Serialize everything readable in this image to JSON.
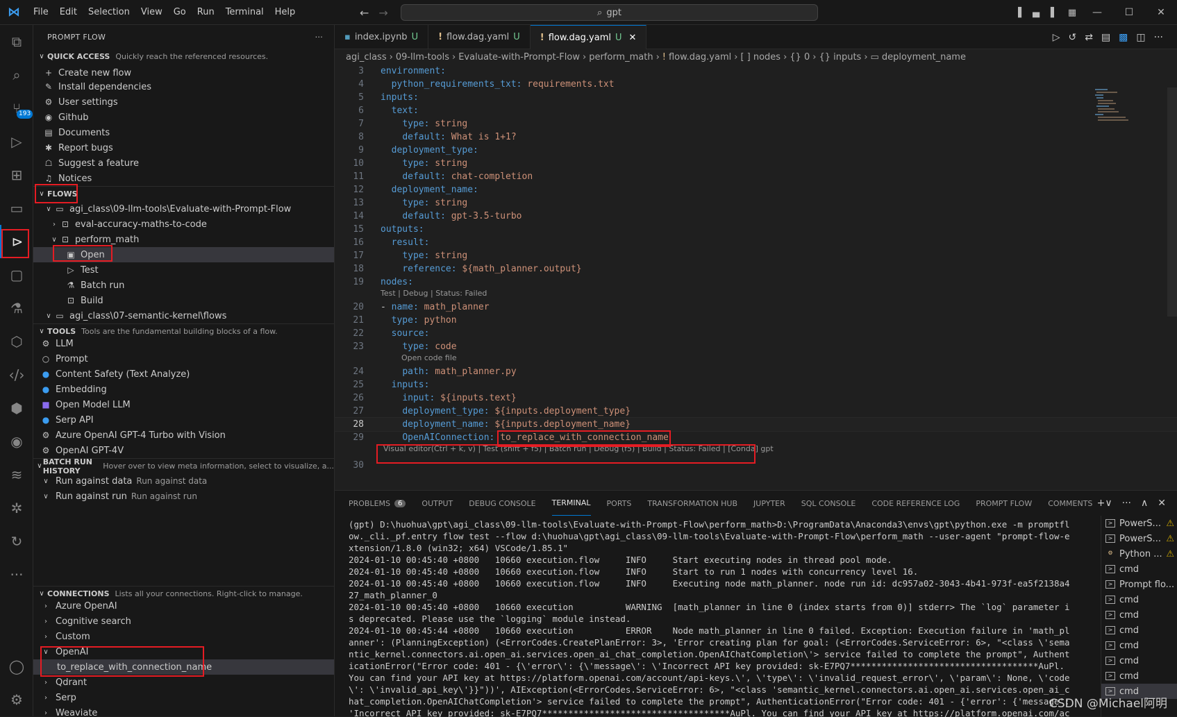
{
  "menu": [
    "File",
    "Edit",
    "Selection",
    "View",
    "Go",
    "Run",
    "Terminal",
    "Help"
  ],
  "search": {
    "text": "gpt"
  },
  "activity": {
    "scm_badge": "193"
  },
  "sidebar": {
    "title": "PROMPT FLOW",
    "quick_access": {
      "title": "QUICK ACCESS",
      "desc": "Quickly reach the referenced resources.",
      "items": [
        "Create new flow",
        "Install dependencies",
        "User settings",
        "Github",
        "Documents",
        "Report bugs",
        "Suggest a feature",
        "Notices"
      ]
    },
    "flows": {
      "title": "FLOWS",
      "root1": "agi_class\\09-llm-tools\\Evaluate-with-Prompt-Flow",
      "child1": "eval-accuracy-maths-to-code",
      "child2": "perform_math",
      "actions": [
        "Open",
        "Test",
        "Batch run",
        "Build"
      ],
      "root2": "agi_class\\07-semantic-kernel\\flows"
    },
    "tools": {
      "title": "TOOLS",
      "desc": "Tools are the fundamental building blocks of a flow.",
      "items": [
        "LLM",
        "Prompt",
        "Content Safety (Text Analyze)",
        "Embedding",
        "Open Model LLM",
        "Serp API",
        "Azure OpenAI GPT-4 Turbo with Vision",
        "OpenAI GPT-4V"
      ]
    },
    "batch": {
      "title": "BATCH RUN HISTORY",
      "desc": "Hover over to view meta information, select to visualize, a...",
      "items": [
        {
          "label": "Run against data",
          "sub": "Run against data"
        },
        {
          "label": "Run against run",
          "sub": "Run against run"
        }
      ]
    },
    "connections": {
      "title": "CONNECTIONS",
      "desc": "Lists all your connections. Right-click to manage.",
      "items": [
        "Azure OpenAI",
        "Cognitive search",
        "Custom",
        "OpenAI"
      ],
      "child": "to_replace_with_connection_name",
      "items2": [
        "Qdrant",
        "Serp",
        "Weaviate"
      ]
    }
  },
  "tabs": [
    {
      "label": "index.ipynb",
      "mark": "U"
    },
    {
      "label": "flow.dag.yaml",
      "mark": "U"
    },
    {
      "label": "flow.dag.yaml",
      "mark": "U"
    }
  ],
  "breadcrumb": [
    "agi_class",
    "09-llm-tools",
    "Evaluate-with-Prompt-Flow",
    "perform_math",
    "flow.dag.yaml",
    "[ ] nodes",
    "{} 0",
    "{} inputs",
    "deployment_name"
  ],
  "code": {
    "l3": "environment:",
    "l4k": "python_requirements_txt:",
    "l4v": "requirements.txt",
    "l5": "inputs:",
    "l6": "text:",
    "l7k": "type:",
    "l7v": "string",
    "l8k": "default:",
    "l8v": "What is 1+1?",
    "l9": "deployment_type:",
    "l10k": "type:",
    "l10v": "string",
    "l11k": "default:",
    "l11v": "chat-completion",
    "l12": "deployment_name:",
    "l13k": "type:",
    "l13v": "string",
    "l14k": "default:",
    "l14v": "gpt-3.5-turbo",
    "l15": "outputs:",
    "l16": "result:",
    "l17k": "type:",
    "l17v": "string",
    "l18k": "reference:",
    "l18v": "${math_planner.output}",
    "l19": "nodes:",
    "lens1": "Test | Debug | Status: Failed",
    "l20k": "name:",
    "l20v": "math_planner",
    "l21k": "type:",
    "l21v": "python",
    "l22": "source:",
    "l23k": "type:",
    "l23v": "code",
    "lens2": "Open code file",
    "l24k": "path:",
    "l24v": "math_planner.py",
    "l25": "inputs:",
    "l26k": "input:",
    "l26v": "${inputs.text}",
    "l27k": "deployment_type:",
    "l27v": "${inputs.deployment_type}",
    "l28k": "deployment_name:",
    "l28v": "${inputs.deployment_name}",
    "l29k": "OpenAIConnection:",
    "l29v": "to_replace_with_connection_name",
    "lens3": "Visual editor(Ctrl + k, v) | Test (shift + f5) | Batch run | Debug (f5) | Build | Status: Failed | [Conda] gpt"
  },
  "panel": {
    "tabs": [
      "PROBLEMS",
      "OUTPUT",
      "DEBUG CONSOLE",
      "TERMINAL",
      "PORTS",
      "TRANSFORMATION HUB",
      "JUPYTER",
      "SQL CONSOLE",
      "CODE REFERENCE LOG",
      "PROMPT FLOW",
      "COMMENTS"
    ],
    "problems_count": "6",
    "terminal": "(gpt) D:\\huohua\\gpt\\agi_class\\09-llm-tools\\Evaluate-with-Prompt-Flow\\perform_math>D:\\ProgramData\\Anaconda3\\envs\\gpt\\python.exe -m promptflow._cli._pf.entry flow test --flow d:\\huohua\\gpt\\agi_class\\09-llm-tools\\Evaluate-with-Prompt-Flow\\perform_math --user-agent \"prompt-flow-extension/1.8.0 (win32; x64) VSCode/1.85.1\"\n2024-01-10 00:45:40 +0800   10660 execution.flow     INFO     Start executing nodes in thread pool mode.\n2024-01-10 00:45:40 +0800   10660 execution.flow     INFO     Start to run 1 nodes with concurrency level 16.\n2024-01-10 00:45:40 +0800   10660 execution.flow     INFO     Executing node math_planner. node run id: dc957a02-3043-4b41-973f-ea5f2138a427_math_planner_0\n2024-01-10 00:45:40 +0800   10660 execution          WARNING  [math_planner in line 0 (index starts from 0)] stderr> The `log` parameter is deprecated. Please use the `logging` module instead.\n2024-01-10 00:45:44 +0800   10660 execution          ERROR    Node math_planner in line 0 failed. Exception: Execution failure in 'math_planner': (PlanningException) (<ErrorCodes.CreatePlanError: 3>, 'Error creating plan for goal: (<ErrorCodes.ServiceError: 6>, \"<class \\'semantic_kernel.connectors.ai.open_ai.services.open_ai_chat_completion.OpenAIChatCompletion\\'> service failed to complete the prompt\", AuthenticationError(\"Error code: 401 - {\\'error\\': {\\'message\\': \\'Incorrect API key provided: sk-E7PQ7************************************AuPl. You can find your API key at https://platform.openai.com/account/api-keys.\\', \\'type\\': \\'invalid_request_error\\', \\'param\\': None, \\'code\\': \\'invalid_api_key\\'}}\"))', AIException(<ErrorCodes.ServiceError: 6>, \"<class 'semantic_kernel.connectors.ai.open_ai.services.open_ai_chat_completion.OpenAIChatCompletion'> service failed to complete the prompt\", AuthenticationError(\"Error code: 401 - {'error': {'message': 'Incorrect API key provided: sk-E7PQ7************************************AuPl. You can find your API key at https://platform.openai.com/account/api-keys.', 'type': 'invalid_request_error', 'param': None, 'code': 'invalid_api_key'}}\")))",
    "terminals": [
      {
        "label": "PowerS...",
        "warn": true
      },
      {
        "label": "PowerS...",
        "warn": true
      },
      {
        "label": "Python ...",
        "warn": true
      },
      {
        "label": "cmd"
      },
      {
        "label": "Prompt flo..."
      },
      {
        "label": "cmd"
      },
      {
        "label": "cmd"
      },
      {
        "label": "cmd"
      },
      {
        "label": "cmd"
      },
      {
        "label": "cmd"
      },
      {
        "label": "cmd"
      },
      {
        "label": "cmd"
      }
    ]
  },
  "watermark": "CSDN @Michael阿明"
}
